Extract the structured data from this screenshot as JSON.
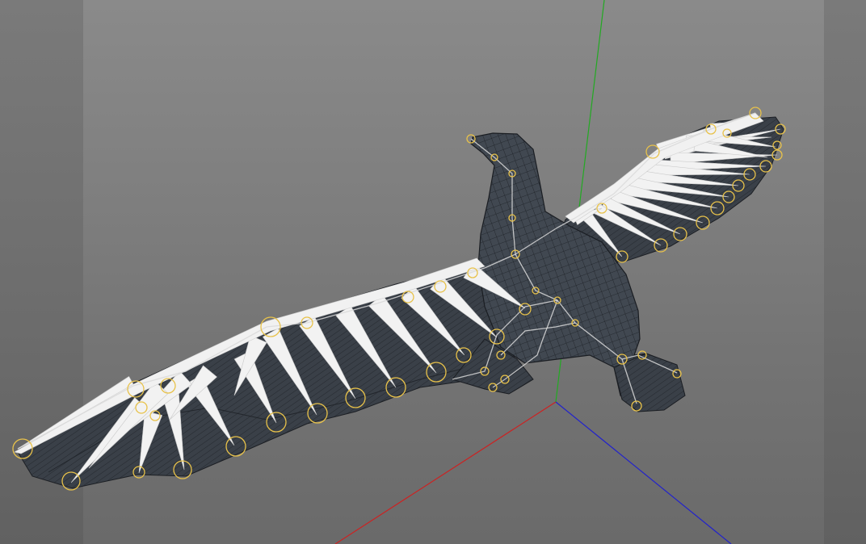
{
  "viewport": {
    "title": "",
    "background_color": "#7d7d7d",
    "axis_colors": {
      "x": "#cc2222",
      "y": "#22aa22",
      "z": "#2222cc"
    },
    "joint_color": "#e8c24a",
    "mesh_color": "#3d434b",
    "feather_color": "#f2f2f2",
    "bone_color": "#d9d9d9"
  },
  "scene": {
    "object": "bird-rig",
    "left_wing_feather_count": 17,
    "right_wing_feather_count": 17
  }
}
